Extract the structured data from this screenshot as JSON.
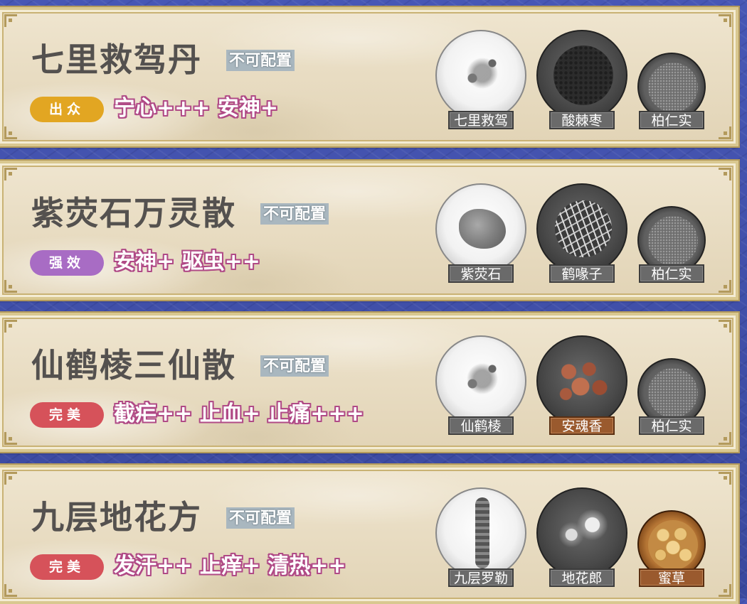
{
  "colors": {
    "grade_chuzhong": "#e2a622",
    "grade_qiangxiao": "#a86cc4",
    "grade_wanmei": "#d6525a",
    "effect_outline": "#b04a86"
  },
  "recipes": [
    {
      "name": "七里救驾丹",
      "config": "不可配置",
      "grade": "出众",
      "grade_color": "#e2a622",
      "effects": "宁心+++ 安神+",
      "ingredients": [
        {
          "name": "七里救驾",
          "icon": "herb-white-plate",
          "rare": false
        },
        {
          "name": "酸棘枣",
          "icon": "seeds-dark-plate",
          "rare": false
        },
        {
          "name": "柏仁实",
          "icon": "grain-bowl",
          "rare": false
        }
      ]
    },
    {
      "name": "紫荧石万灵散",
      "config": "不可配置",
      "grade": "强效",
      "grade_color": "#a86cc4",
      "effects": "安神+ 驱虫++",
      "ingredients": [
        {
          "name": "紫荧石",
          "icon": "stone-white-plate",
          "rare": false
        },
        {
          "name": "鹤喙子",
          "icon": "rice-dark-plate",
          "rare": false
        },
        {
          "name": "柏仁实",
          "icon": "grain-bowl",
          "rare": false
        }
      ]
    },
    {
      "name": "仙鹤棱三仙散",
      "config": "不可配置",
      "grade": "完美",
      "grade_color": "#d6525a",
      "effects": "截疟++ 止血+ 止痛+++",
      "ingredients": [
        {
          "name": "仙鹤棱",
          "icon": "herb-white-plate",
          "rare": false
        },
        {
          "name": "安魂香",
          "icon": "amber-dark-plate",
          "rare": true
        },
        {
          "name": "柏仁实",
          "icon": "grain-bowl",
          "rare": false
        }
      ]
    },
    {
      "name": "九层地花方",
      "config": "不可配置",
      "grade": "完美",
      "grade_color": "#d6525a",
      "effects": "发汗++ 止痒+ 清热++",
      "ingredients": [
        {
          "name": "九层罗勒",
          "icon": "spike-white-plate",
          "rare": false
        },
        {
          "name": "地花郎",
          "icon": "thistle-dark-plate",
          "rare": false
        },
        {
          "name": "蜜草",
          "icon": "slices-wood-bowl",
          "rare": true
        }
      ]
    }
  ]
}
